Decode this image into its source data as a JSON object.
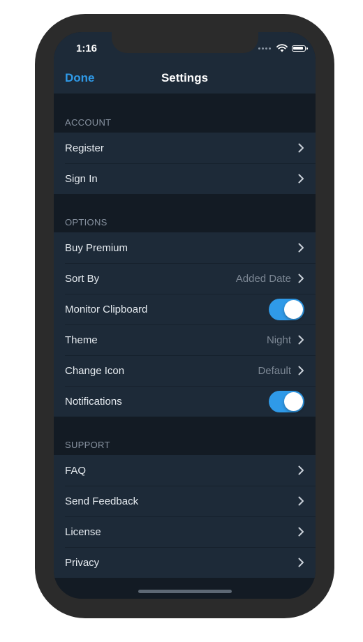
{
  "status_bar": {
    "time": "1:16"
  },
  "nav": {
    "done_label": "Done",
    "title": "Settings"
  },
  "sections": {
    "account": {
      "header": "ACCOUNT",
      "rows": [
        {
          "label": "Register"
        },
        {
          "label": "Sign In"
        }
      ]
    },
    "options": {
      "header": "OPTIONS",
      "rows": [
        {
          "label": "Buy Premium"
        },
        {
          "label": "Sort By",
          "value": "Added Date"
        },
        {
          "label": "Monitor Clipboard",
          "toggle_on": true
        },
        {
          "label": "Theme",
          "value": "Night"
        },
        {
          "label": "Change Icon",
          "value": "Default"
        },
        {
          "label": "Notifications",
          "toggle_on": true
        }
      ]
    },
    "support": {
      "header": "SUPPORT",
      "rows": [
        {
          "label": "FAQ"
        },
        {
          "label": "Send Feedback"
        },
        {
          "label": "License"
        },
        {
          "label": "Privacy"
        }
      ]
    }
  },
  "icons": {
    "chevron": "chevron-right-icon",
    "wifi": "wifi-icon",
    "battery": "battery-icon",
    "signal": "signal-icon"
  },
  "colors": {
    "accent": "#2f9ae8",
    "background": "#131b24",
    "cell": "#1d2a38",
    "section_text": "#8792a0",
    "value_text": "#7c8794"
  }
}
